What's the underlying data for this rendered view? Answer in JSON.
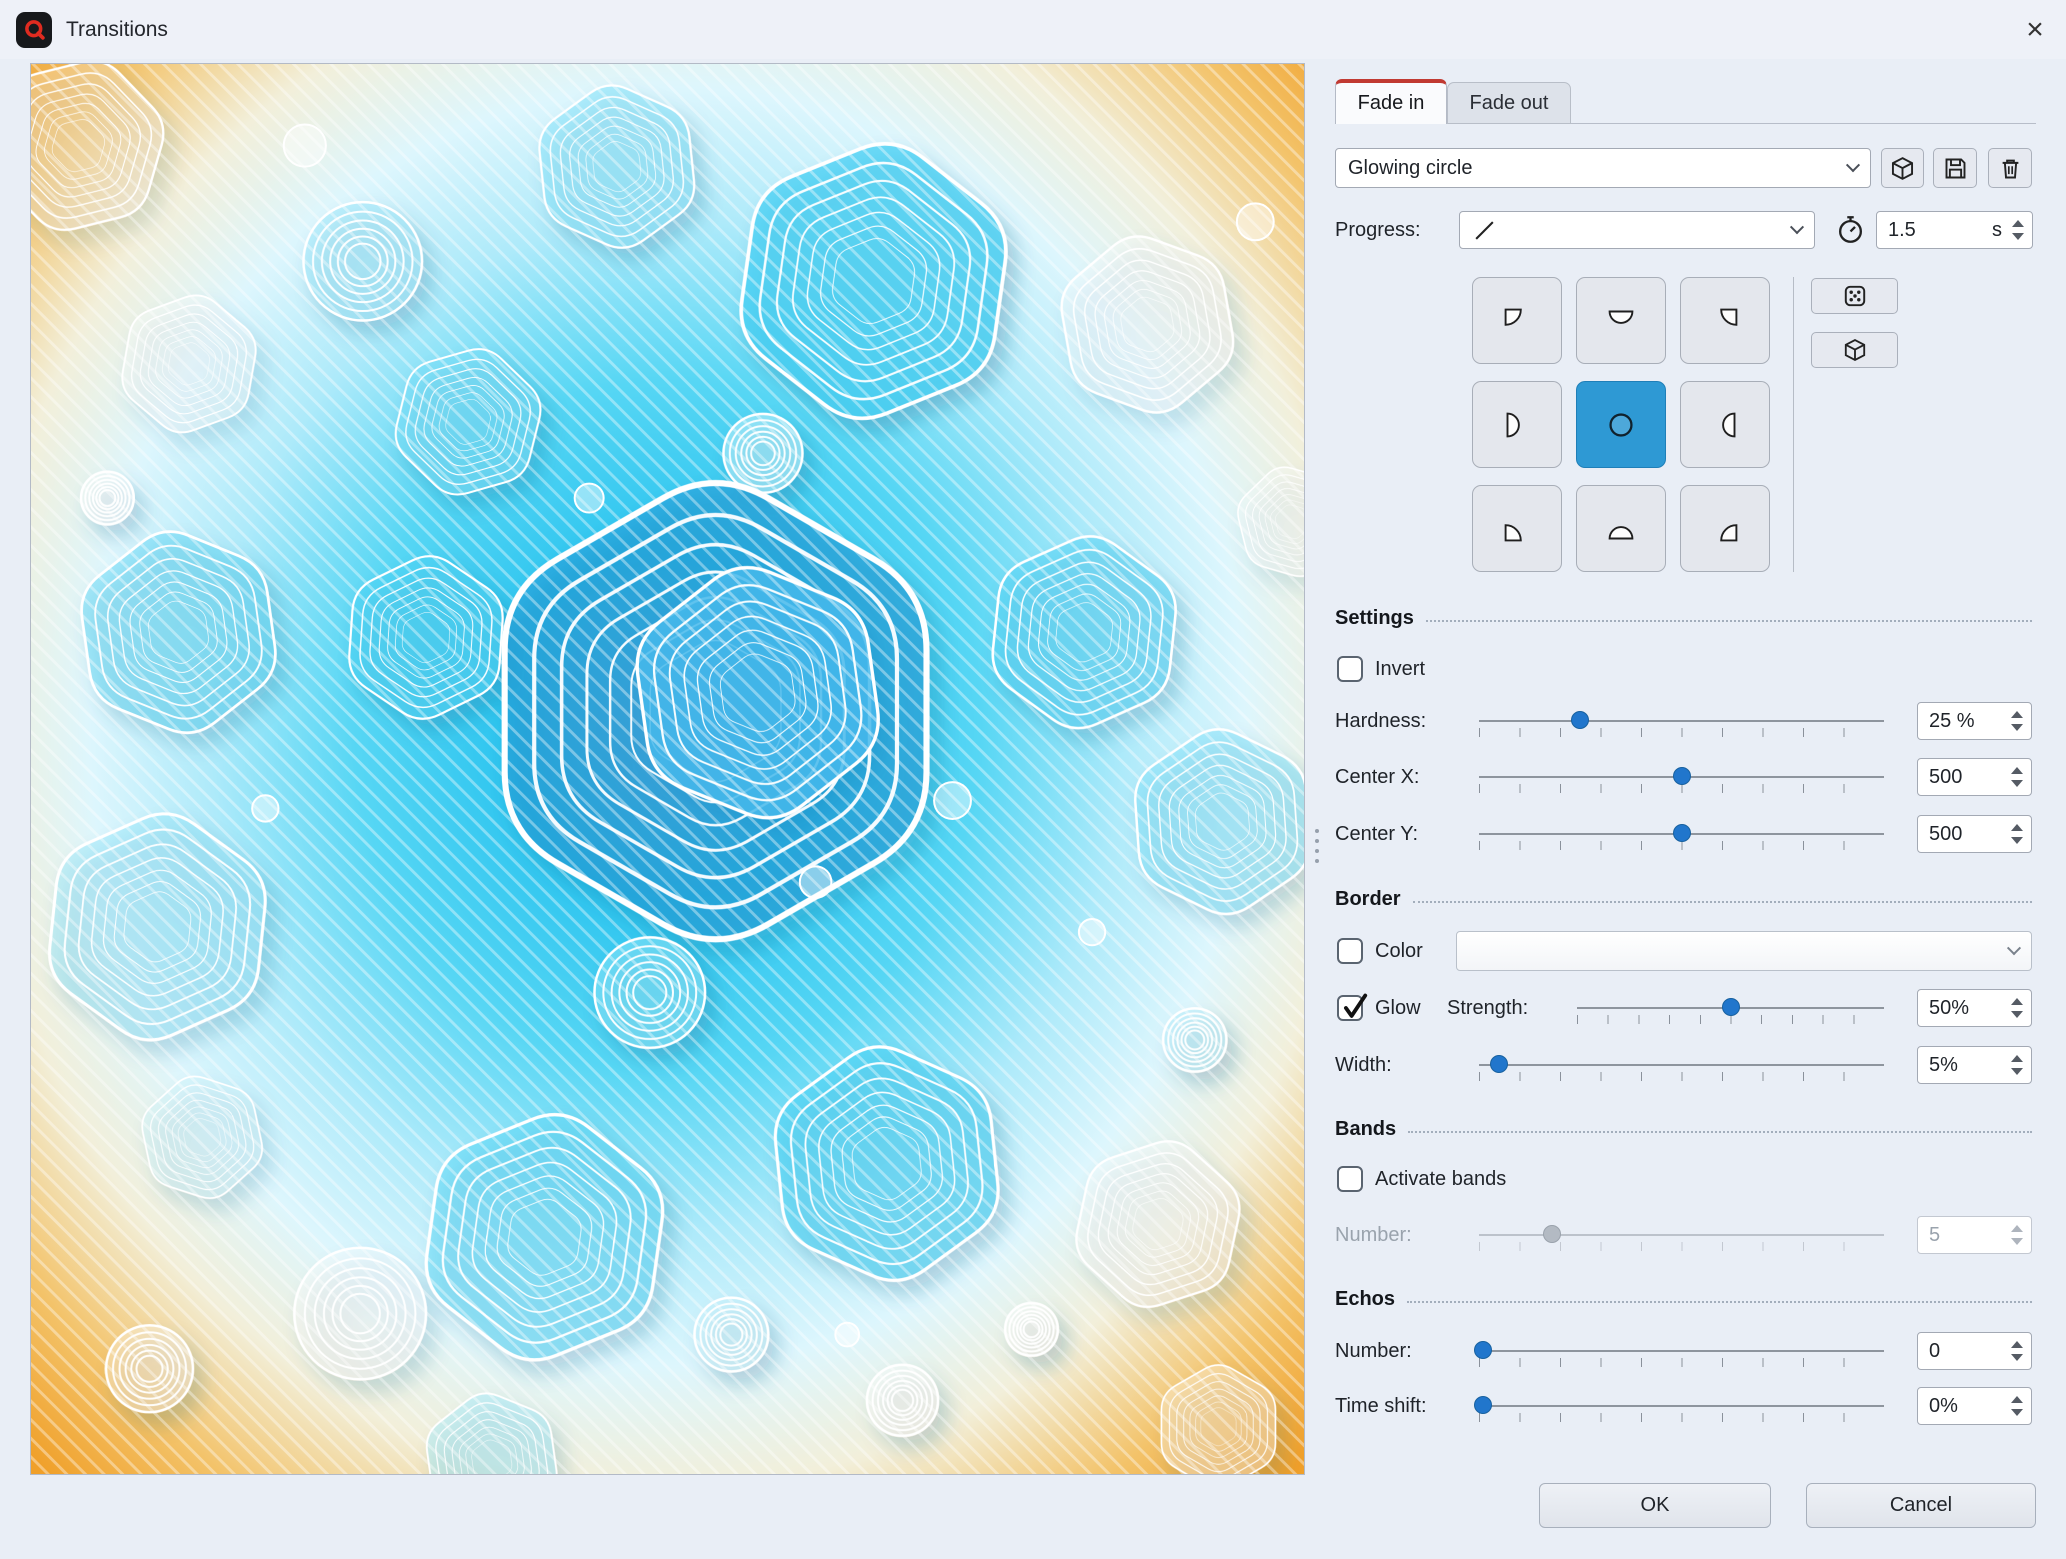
{
  "window": {
    "title": "Transitions"
  },
  "icons": {
    "app_logo": "aquasoft-swirl",
    "close": "×",
    "load_preset": "cube",
    "save_preset": "floppy-disk",
    "delete_preset": "trash",
    "progress_curve": "linear-diagonal",
    "timer": "stopwatch",
    "randomize": "dice",
    "preview_3d": "cube"
  },
  "colors": {
    "tab_accent": "#c13a32",
    "selected_button": "#2e99d4",
    "slider_thumb": "#2176cc"
  },
  "tabs": {
    "fade_in": "Fade in",
    "fade_out": "Fade out"
  },
  "preset": {
    "value": "Glowing circle"
  },
  "progress": {
    "label": "Progress:",
    "duration": "1.5",
    "unit": "s"
  },
  "origin": {
    "selected": "center"
  },
  "sections": {
    "settings": "Settings",
    "border": "Border",
    "bands": "Bands",
    "echos": "Echos"
  },
  "settings": {
    "invert": {
      "label": "Invert",
      "checked": false
    },
    "hardness": {
      "label": "Hardness:",
      "value": "25 %",
      "percent": 25
    },
    "center_x": {
      "label": "Center X:",
      "value": "500",
      "percent": 50
    },
    "center_y": {
      "label": "Center Y:",
      "value": "500",
      "percent": 50
    }
  },
  "border": {
    "color": {
      "label": "Color",
      "checked": false
    },
    "glow": {
      "label": "Glow",
      "checked": true
    },
    "strength": {
      "label": "Strength:",
      "value": "50%",
      "percent": 50
    },
    "width": {
      "label": "Width:",
      "value": "5%",
      "percent": 5
    }
  },
  "bands": {
    "activate": {
      "label": "Activate bands",
      "checked": false
    },
    "number": {
      "label": "Number:",
      "value": "5",
      "percent": 18,
      "disabled": true
    }
  },
  "echos": {
    "number": {
      "label": "Number:",
      "value": "0",
      "percent": 1
    },
    "time_shift": {
      "label": "Time shift:",
      "value": "0%",
      "percent": 1
    }
  },
  "footer": {
    "ok": "OK",
    "cancel": "Cancel"
  }
}
